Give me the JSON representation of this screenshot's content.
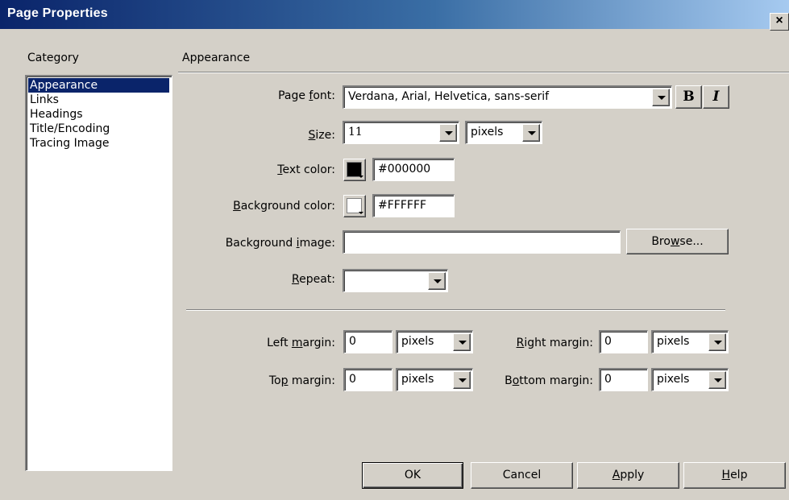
{
  "dialog": {
    "title": "Page Properties",
    "close_label": "×"
  },
  "category": {
    "header": "Category",
    "items": [
      "Appearance",
      "Links",
      "Headings",
      "Title/Encoding",
      "Tracing Image"
    ],
    "selected": "Appearance"
  },
  "section": {
    "title": "Appearance"
  },
  "page_font": {
    "label_pre": "Page ",
    "label_ul": "f",
    "label_post": "ont:",
    "value": "Verdana, Arial, Helvetica, sans-serif",
    "bold_label": "B",
    "italic_label": "I"
  },
  "size": {
    "label_pre": "",
    "label_ul": "S",
    "label_post": "ize:",
    "value": "11",
    "unit": "pixels"
  },
  "text_color": {
    "label_pre": "",
    "label_ul": "T",
    "label_post": "ext color:",
    "swatch": "#000000",
    "value": "#000000"
  },
  "background_color": {
    "label_pre": "",
    "label_ul": "B",
    "label_post": "ackground color:",
    "swatch": "#FFFFFF",
    "value": "#FFFFFF"
  },
  "background_image": {
    "label_pre": "Background ",
    "label_ul": "i",
    "label_post": "mage:",
    "value": "",
    "browse_pre": "Bro",
    "browse_ul": "w",
    "browse_post": "se..."
  },
  "repeat": {
    "label_pre": "",
    "label_ul": "R",
    "label_post": "epeat:",
    "value": ""
  },
  "margins": {
    "left": {
      "label_pre": "Left ",
      "label_ul": "m",
      "label_post": "argin:",
      "value": "0",
      "unit": "pixels"
    },
    "right": {
      "label_pre": "",
      "label_ul": "R",
      "label_post": "ight margin:",
      "value": "0",
      "unit": "pixels"
    },
    "top": {
      "label_pre": "To",
      "label_ul": "p",
      "label_post": " margin:",
      "value": "0",
      "unit": "pixels"
    },
    "bottom": {
      "label_pre": "B",
      "label_ul": "o",
      "label_post": "ttom margin:",
      "value": "0",
      "unit": "pixels"
    }
  },
  "buttons": {
    "ok": "OK",
    "cancel": "Cancel",
    "apply_ul": "A",
    "apply_post": "pply",
    "help_ul": "H",
    "help_post": "elp"
  }
}
